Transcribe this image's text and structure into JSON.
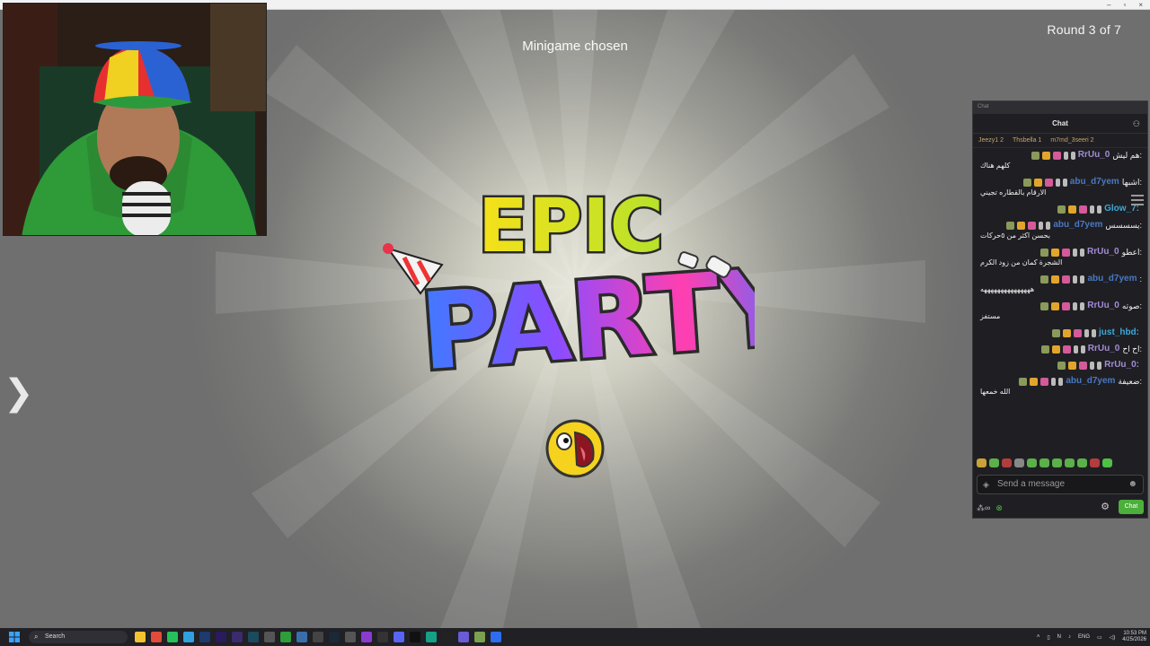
{
  "window": {
    "controls": [
      "–",
      "▫",
      "×"
    ]
  },
  "game": {
    "round_label": "Round 3 of 7",
    "status": "Minigame chosen",
    "logo_line1": "EPIC",
    "logo_line2": "PARTY",
    "nav_arrow": "❯"
  },
  "chat": {
    "top_label": "Chat",
    "header": "Chat",
    "chips": [
      "Jeezy1 2",
      "Thsbella 1",
      "m7md_3seeri 2"
    ],
    "messages": [
      {
        "user": "RrUu_0",
        "color": "#a38cd6",
        "text": "هم ليش:",
        "body": "كلهم هناك"
      },
      {
        "user": "abu_d7yem",
        "color": "#4a78c2",
        "text": "اشبها:",
        "body": "الارقام بالقطاره تجيني"
      },
      {
        "user": "Glow_7:",
        "color": "#3fa7d8",
        "text": "",
        "body": ""
      },
      {
        "user": "abu_d7yem",
        "color": "#4a78c2",
        "text": "يسسسس:",
        "body": "بحسن اكثر من ٥حركات"
      },
      {
        "user": "RrUu_0",
        "color": "#a38cd6",
        "text": "اعطو:",
        "body": "الشجرة كمان من زود الكرم"
      },
      {
        "user": "abu_d7yem",
        "color": "#4a78c2",
        "text": ":",
        "body": "هههههههههههههههه"
      },
      {
        "user": "RrUu_0",
        "color": "#a38cd6",
        "text": "صوته:",
        "body": "مستفز"
      },
      {
        "user": "just_hbd:",
        "color": "#3fa7d8",
        "text": "",
        "body": ""
      },
      {
        "user": "RrUu_0",
        "color": "#a38cd6",
        "text": "اح اح:",
        "body": ""
      },
      {
        "user": "RrUu_0:",
        "color": "#a38cd6",
        "text": "",
        "body": ""
      },
      {
        "user": "abu_d7yem",
        "color": "#4a78c2",
        "text": "ضعيفة:",
        "body": "الله خمعها"
      }
    ],
    "input_placeholder": "Send a message",
    "send_label": "Chat"
  },
  "taskbar": {
    "search_placeholder": "Search",
    "lang": "ENG",
    "time": "10:53 PM",
    "date": "4/25/2026"
  },
  "colors": {
    "chat_bg": "#1f1f23",
    "accent_green": "#4caf3b",
    "taskbar_bg": "#202025"
  }
}
